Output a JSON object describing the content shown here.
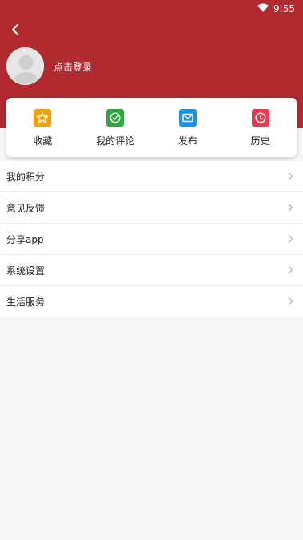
{
  "status": {
    "time": "9:55",
    "wifi_icon": "wifi-icon"
  },
  "header": {
    "background": "#b02a2f",
    "back_icon": "chevron-left-icon",
    "login_text": "点击登录"
  },
  "shortcuts": [
    {
      "label": "收藏",
      "icon": "star-icon",
      "color": "#f5a000"
    },
    {
      "label": "我的评论",
      "icon": "comment-icon",
      "color": "#2fa83a"
    },
    {
      "label": "发布",
      "icon": "mail-icon",
      "color": "#1e90e0"
    },
    {
      "label": "历史",
      "icon": "clock-icon",
      "color": "#e83a4e"
    }
  ],
  "menu": [
    {
      "label": "我的积分"
    },
    {
      "label": "意见反馈"
    },
    {
      "label": "分享app"
    },
    {
      "label": "系统设置"
    },
    {
      "label": "生活服务"
    }
  ],
  "chevron_icon": "chevron-right-icon"
}
